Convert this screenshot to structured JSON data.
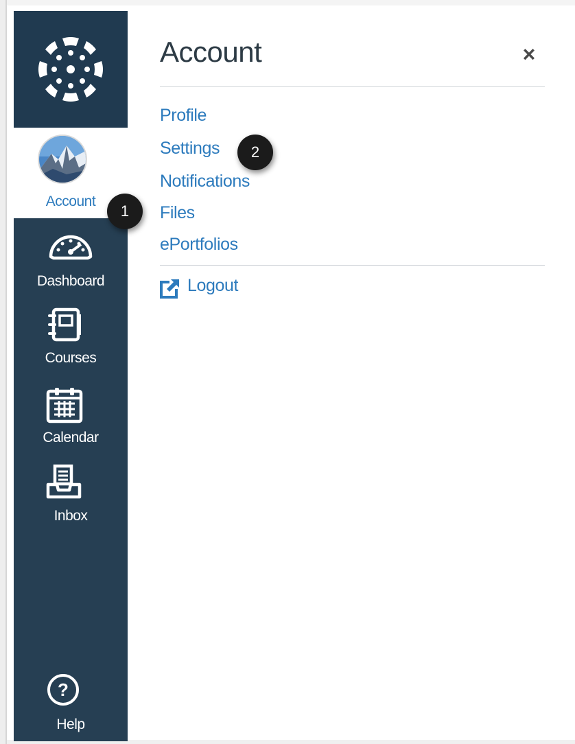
{
  "nav": {
    "account_label": "Account",
    "items": [
      {
        "label": "Dashboard",
        "icon": "dashboard-icon"
      },
      {
        "label": "Courses",
        "icon": "courses-icon"
      },
      {
        "label": "Calendar",
        "icon": "calendar-icon"
      },
      {
        "label": "Inbox",
        "icon": "inbox-icon"
      }
    ],
    "help_label": "Help",
    "colors": {
      "nav_bg": "#263f53",
      "logo_bg": "#203a50",
      "link": "#2d7bbd"
    }
  },
  "tray": {
    "title": "Account",
    "close_symbol": "×",
    "links": [
      "Profile",
      "Settings",
      "Notifications",
      "Files",
      "ePortfolios"
    ],
    "logout_label": "Logout"
  },
  "callouts": [
    "1",
    "2"
  ]
}
